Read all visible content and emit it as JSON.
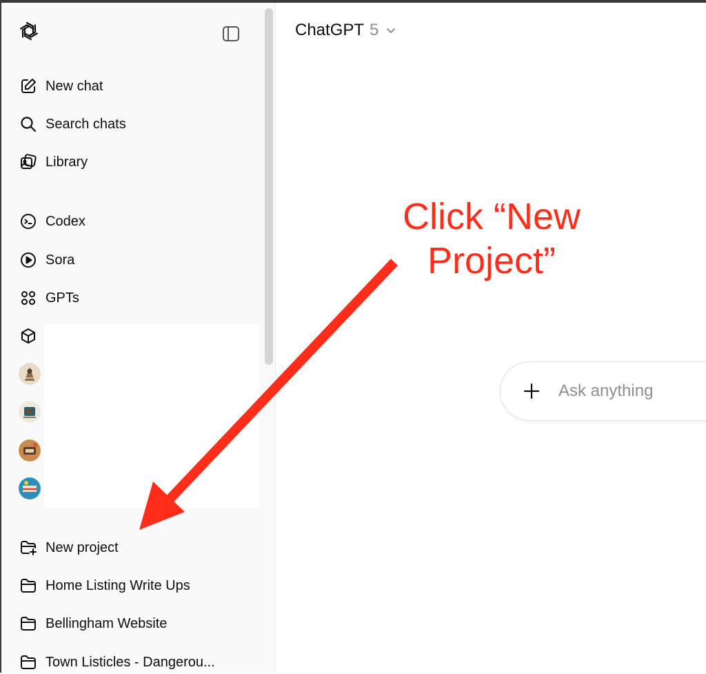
{
  "sidebar": {
    "logo_icon": "openai-logo-icon",
    "toggle_icon": "sidebar-toggle-icon",
    "primary_items": [
      {
        "label": "New chat",
        "icon": "edit-icon"
      },
      {
        "label": "Search chats",
        "icon": "search-icon"
      },
      {
        "label": "Library",
        "icon": "library-icon"
      }
    ],
    "app_items": [
      {
        "label": "Codex",
        "icon": "codex-icon"
      },
      {
        "label": "Sora",
        "icon": "play-icon"
      },
      {
        "label": "GPTs",
        "icon": "grid-icon"
      }
    ],
    "project_items": [
      {
        "label": "New project",
        "icon": "folder-plus-icon"
      },
      {
        "label": "Home Listing Write Ups",
        "icon": "folder-icon"
      },
      {
        "label": "Bellingham Website",
        "icon": "folder-icon"
      },
      {
        "label": "Town Listicles - Dangerou...",
        "icon": "folder-icon"
      }
    ]
  },
  "header": {
    "model_name": "ChatGPT",
    "model_version": "5",
    "dropdown_icon": "chevron-down-icon"
  },
  "composer": {
    "placeholder": "Ask anything",
    "attach_icon": "plus-icon"
  },
  "annotation": {
    "line1": "Click “New",
    "line2": "Project”",
    "color": "#ff2d1a"
  },
  "colors": {
    "sidebar_bg": "#f9f9f9",
    "text": "#0d0d0d",
    "muted": "#8f8f8f",
    "annotation": "#ff2d1a"
  }
}
